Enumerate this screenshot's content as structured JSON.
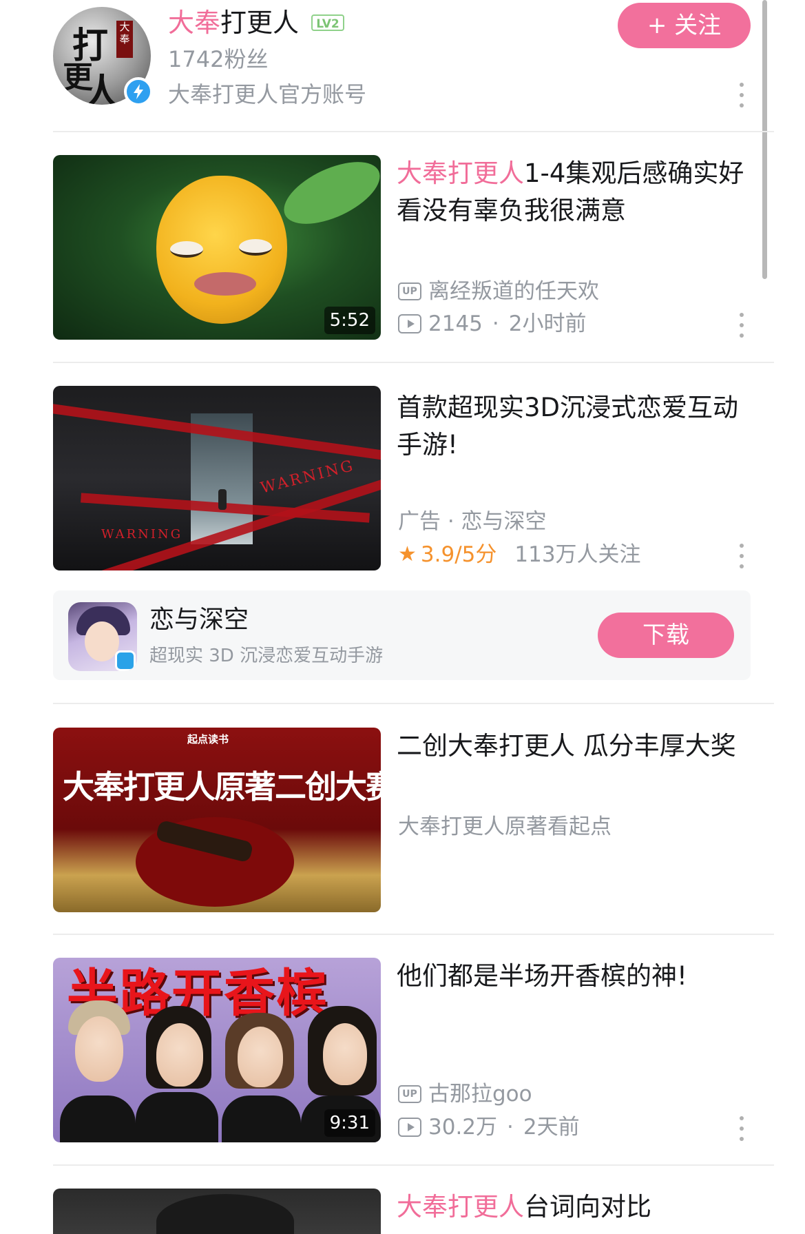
{
  "header": {
    "name_highlight": "大奉",
    "name_rest": "打更人",
    "level": "LV2",
    "fans": "1742粉丝",
    "description": "大奉打更人官方账号",
    "follow_label": "+ 关注",
    "avatar_text": "打更人"
  },
  "feed": [
    {
      "title_highlight": "大奉打更人",
      "title_rest": "1-4集观后感确实好看没有辜负我很满意",
      "duration": "5:52",
      "uploader": "离经叛道的任天欢",
      "views": "2145",
      "time": "2小时前"
    },
    {
      "title": "首款超现实3D沉浸式恋爱互动手游!",
      "ad_meta": "广告 · 恋与深空",
      "rating": "3.9/5分",
      "followers": "113万人关注",
      "thumb_text": "WARNING",
      "app": {
        "name": "恋与深空",
        "desc": "超现实 3D 沉浸恋爱互动手游",
        "download_label": "下载"
      }
    },
    {
      "title": "二创大奉打更人 瓜分丰厚大奖",
      "subtitle": "大奉打更人原著看起点",
      "thumb_title": "大奉打更人原著二创大赛",
      "thumb_brand": "起点读书"
    },
    {
      "title": "他们都是半场开香槟的神!",
      "thumb_title": "半路开香槟",
      "duration": "9:31",
      "uploader": "古那拉goo",
      "views": "30.2万",
      "time": "2天前"
    },
    {
      "title_highlight": "大奉打更人",
      "title_rest": "台词向对比"
    }
  ],
  "icons": {
    "up": "UP",
    "verified": "lightning-icon",
    "play": "play-icon",
    "more": "more-vertical-icon",
    "star": "★"
  },
  "colors": {
    "accent": "#f2709c",
    "highlight_text": "#f16d99",
    "rating": "#f5922d",
    "meta": "#9499a0"
  }
}
